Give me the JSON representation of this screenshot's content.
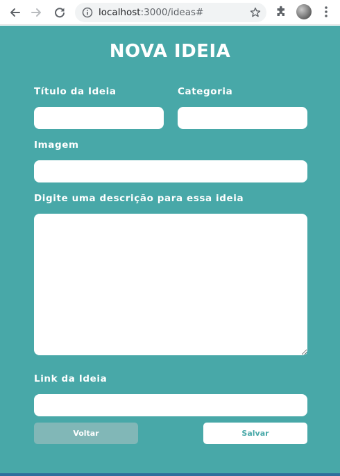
{
  "browser": {
    "url_host": "localhost",
    "url_path": ":3000/ideas#",
    "icons": [
      "back-arrow-icon",
      "forward-arrow-icon",
      "reload-icon",
      "info-icon",
      "star-icon",
      "extensions-icon",
      "profile-avatar",
      "more-menu-icon"
    ]
  },
  "form": {
    "heading": "NOVA IDEIA",
    "title_label": "Título da Ideia",
    "title_value": "",
    "category_label": "Categoria",
    "category_value": "",
    "image_label": "Imagem",
    "image_value": "",
    "description_label": "Digite uma descrição para essa ideia",
    "description_value": "",
    "link_label": "Link da Ideia",
    "link_value": "",
    "back_label": "Voltar",
    "save_label": "Salvar"
  },
  "colors": {
    "page_background": "#48a8a8",
    "field_background": "#ffffff",
    "back_button": "#81b7b7",
    "save_button_text": "#48a8a8"
  }
}
